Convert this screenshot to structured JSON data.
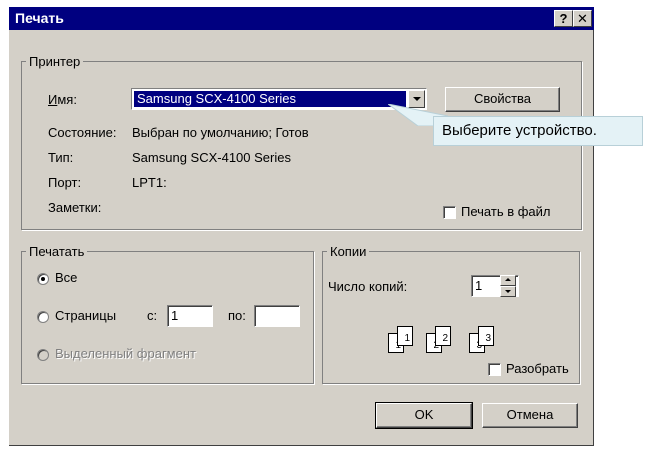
{
  "dialog": {
    "title": "Печать",
    "help_button": "?",
    "close_button": "✕"
  },
  "printer": {
    "group_label": "Принтер",
    "name_label_accel": "И",
    "name_label_rest": "мя:",
    "name_value": "Samsung SCX-4100 Series",
    "properties_button": "Свойства",
    "status_label": "Состояние:",
    "status_value": "Выбран по умолчанию; Готов",
    "type_label": "Тип:",
    "type_value": "Samsung SCX-4100 Series",
    "port_label": "Порт:",
    "port_value": "LPT1:",
    "notes_label": "Заметки:",
    "print_to_file_label": "Печать в файл",
    "print_to_file_checked": false
  },
  "callout": {
    "text": "Выберите устройство."
  },
  "print_range": {
    "group_label": "Печатать",
    "all_label": "Все",
    "pages_label": "Страницы",
    "from_label": "с:",
    "from_value": "1",
    "to_label": "по:",
    "to_value": "",
    "selection_label": "Выделенный фрагмент",
    "selected": "all"
  },
  "copies": {
    "group_label": "Копии",
    "count_label": "Число копий:",
    "count_value": "1",
    "collate_label": "Разобрать",
    "collate_checked": false,
    "page_digits": [
      "1",
      "1",
      "2",
      "2",
      "3",
      "3"
    ]
  },
  "footer": {
    "ok_label": "OK",
    "cancel_label": "Отмена"
  }
}
